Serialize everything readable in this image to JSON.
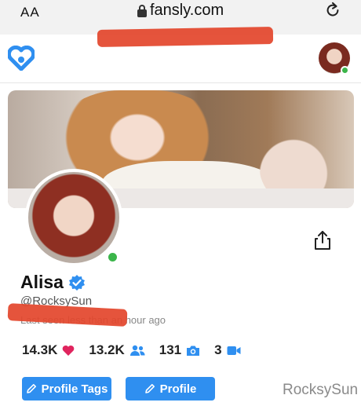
{
  "browser": {
    "text_size_button": "AA",
    "url": "fansly.com"
  },
  "site": {
    "logo_icon": "fansly-heart-logo-icon"
  },
  "profile": {
    "name": "Alisa",
    "handle": "@RocksySun",
    "last_seen": "Last seen less than an hour ago",
    "online": true,
    "verified": true
  },
  "stats": [
    {
      "value": "14.3K",
      "icon": "heart-icon",
      "color": "#e0245e"
    },
    {
      "value": "13.2K",
      "icon": "followers-icon",
      "color": "#2f8ff0"
    },
    {
      "value": "131",
      "icon": "camera-icon",
      "color": "#2f8ff0"
    },
    {
      "value": "3",
      "icon": "video-icon",
      "color": "#2f8ff0"
    }
  ],
  "buttons": {
    "profile_tags": "Profile Tags",
    "profile": "Profile"
  },
  "watermark": "RocksySun",
  "colors": {
    "accent": "#2f8ff0",
    "online": "#3bb54a",
    "redaction": "#e3452b"
  }
}
